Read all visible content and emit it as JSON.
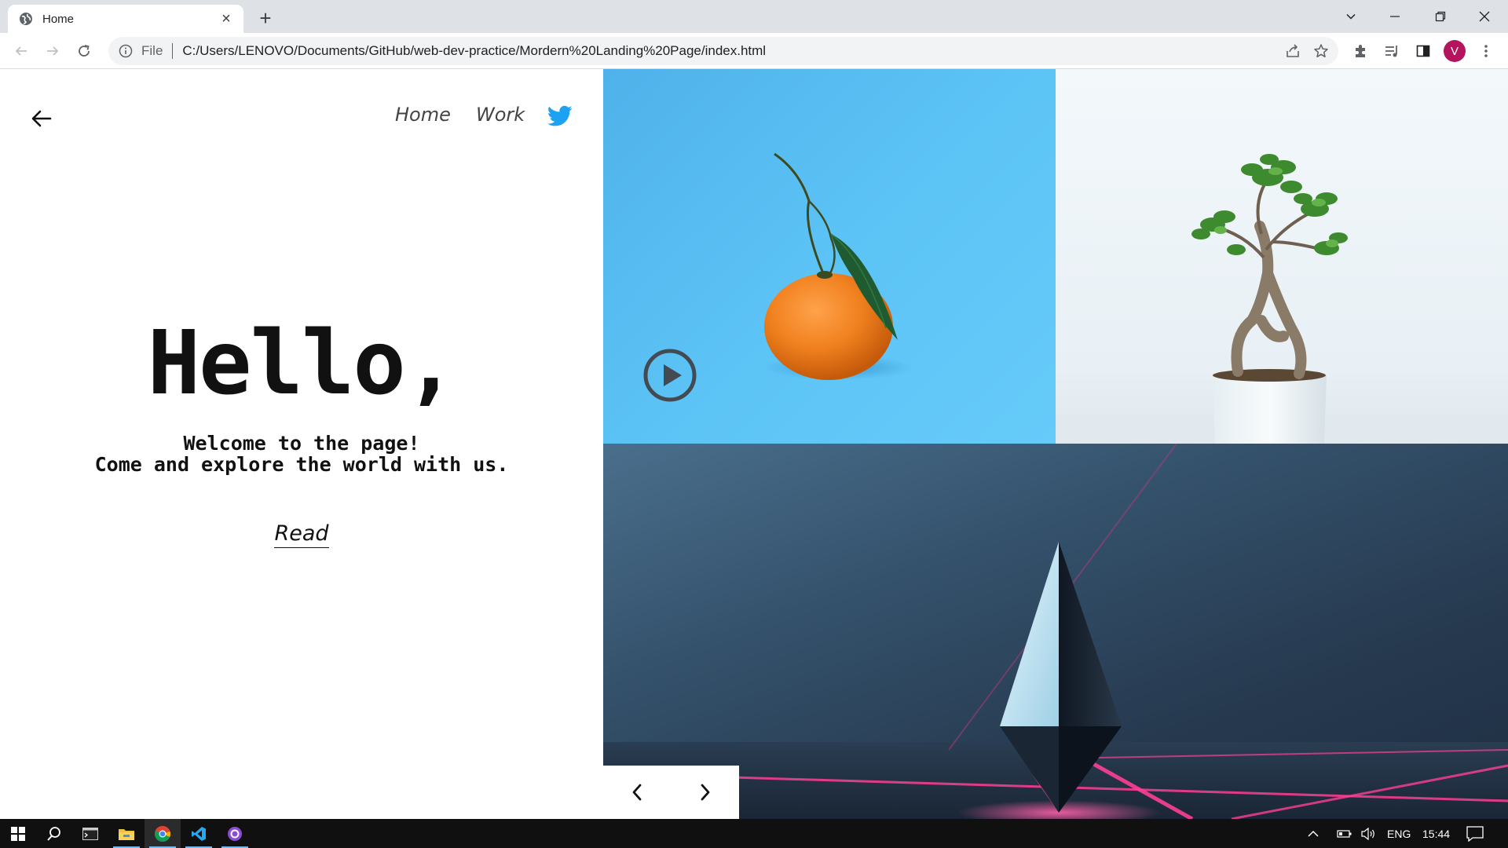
{
  "browser": {
    "tab_title": "Home",
    "tab_close": "×",
    "new_tab": "+",
    "omnibox_scheme": "File",
    "url": "C:/Users/LENOVO/Documents/GitHub/web-dev-practice/Mordern%20Landing%20Page/index.html",
    "profile_initial": "V",
    "accent": "#b5135d"
  },
  "nav": {
    "home": "Home",
    "work": "Work",
    "social_icon": "twitter-icon",
    "twitter_color": "#1da1f2"
  },
  "hero": {
    "title": "Hello,",
    "line1": "Welcome to the page!",
    "line2": "Come and explore the world with us.",
    "read": "Read"
  },
  "gallery": {
    "tiles": [
      "orange-image",
      "bonsai-plant-image",
      "crystal-prism-image"
    ]
  },
  "taskbar": {
    "lang": "ENG",
    "time": "15:44"
  }
}
